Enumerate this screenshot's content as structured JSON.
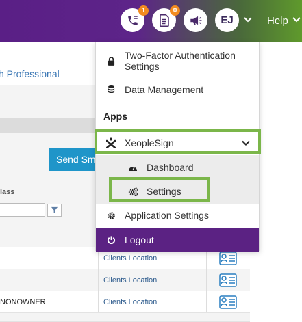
{
  "header": {
    "notifications": [
      {
        "icon": "phone-icon",
        "count": "1"
      },
      {
        "icon": "document-icon",
        "count": "0"
      }
    ],
    "announcement_icon": "megaphone-icon",
    "avatar_initials": "EJ",
    "help_label": "Help"
  },
  "background": {
    "title_fragment": "h Professional",
    "send_button_label": "Send Sm",
    "column_label": "lass",
    "rows": [
      {
        "name": "",
        "location": "Clients Location"
      },
      {
        "name": "",
        "location": "Clients Location"
      },
      {
        "name": "NONOWNER",
        "location": "Clients Location"
      }
    ]
  },
  "menu": {
    "two_factor_label": "Two-Factor Authentication Settings",
    "data_management_label": "Data Management",
    "apps_section_label": "Apps",
    "app_name": "XeopleSign",
    "sub_items": [
      {
        "label": "Dashboard",
        "icon": "dashboard-icon"
      },
      {
        "label": "Settings",
        "icon": "cogs-icon"
      }
    ],
    "application_settings_label": "Application Settings",
    "logout_label": "Logout"
  },
  "colors": {
    "brand_purple": "#5b2283",
    "highlight_green": "#7bb64a",
    "badge_orange": "#f28b1f",
    "link_blue": "#3c78b5"
  }
}
